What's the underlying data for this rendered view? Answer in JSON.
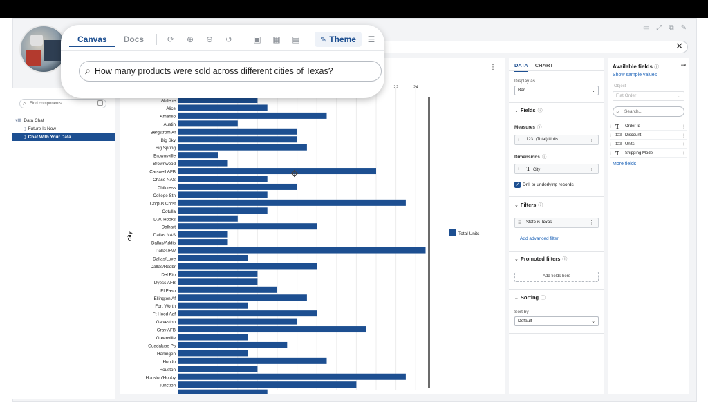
{
  "overlay": {
    "tabs": [
      {
        "label": "Canvas",
        "active": true
      },
      {
        "label": "Docs",
        "active": false
      }
    ],
    "toolbar_icons": [
      "refresh-icon",
      "zoom-in-icon",
      "zoom-out-icon",
      "zoom-reset-icon",
      "image-icon",
      "grid-icon",
      "layout-icon"
    ],
    "theme_label": "Theme",
    "question": "How many products were sold across different cities of Texas?"
  },
  "left": {
    "find_placeholder": "Find components",
    "tree": [
      {
        "label": "Data Chat",
        "level": 1,
        "selected": false
      },
      {
        "label": "Future Is Now",
        "level": 2,
        "selected": false
      },
      {
        "label": "Chat With Your Data",
        "level": 2,
        "selected": true
      }
    ]
  },
  "data_panel": {
    "tabs": [
      {
        "label": "DATA",
        "active": true
      },
      {
        "label": "CHART",
        "active": false
      }
    ],
    "display_as_label": "Display as",
    "display_as_value": "Bar",
    "fields_title": "Fields",
    "measures_label": "Measures",
    "measure_pill": "(Total) Units",
    "measure_type": "123",
    "dimensions_label": "Dimensions",
    "dimension_pill": "City",
    "drill_label": "Drill to underlying records",
    "filters_title": "Filters",
    "filter_pill": "State is Texas",
    "add_filter_link": "Add advanced filter",
    "promoted_title": "Promoted filters",
    "add_fields_here": "Add fields here",
    "sorting_title": "Sorting",
    "sort_by_label": "Sort by",
    "sort_by_value": "Default"
  },
  "fields_panel": {
    "title": "Available fields",
    "sample_link": "Show sample values",
    "object_label": "Object",
    "object_value": "Flat Order",
    "search_placeholder": "Search...",
    "fields": [
      {
        "type": "T",
        "name": "Order Id"
      },
      {
        "type": "123",
        "name": "Discount"
      },
      {
        "type": "123",
        "name": "Units"
      },
      {
        "type": "T",
        "name": "Shipping Mode"
      }
    ],
    "more_link": "More fields"
  },
  "chart_data": {
    "type": "bar",
    "orientation": "horizontal",
    "ylabel": "City",
    "xlabel": "",
    "x_ticks_visible": [
      22,
      24
    ],
    "xlim": [
      0,
      25
    ],
    "legend": {
      "placement": "right",
      "entries": [
        "Total Units"
      ]
    },
    "bar_color": "#1d4f91",
    "series": [
      {
        "name": "Total Units",
        "values": [
          8,
          9,
          15,
          6,
          12,
          12,
          13,
          4,
          5,
          20,
          9,
          12,
          9,
          23,
          9,
          6,
          14,
          5,
          5,
          25,
          7,
          14,
          8,
          8,
          10,
          13,
          7,
          14,
          12,
          19,
          7,
          11,
          7,
          15,
          8,
          23,
          18,
          9
        ]
      }
    ],
    "categories": [
      "Abilene",
      "Alice",
      "Amarillo",
      "Austin",
      "Bergstrom Af",
      "Big Sky",
      "Big Spring",
      "Brownsville",
      "Brownwood",
      "Carswell AFB",
      "Chase NAS",
      "Childress",
      "College Stn",
      "Corpus Chrst",
      "Cotulla",
      "D.w. Hooks",
      "Dalhart",
      "Dallas NAS",
      "Dallas/Addis",
      "Dallas/FW",
      "Dallas/Love",
      "Dallas/Redbr",
      "Del Rio",
      "Dyess AFB",
      "El Paso",
      "Ellington Af",
      "Fort Worth",
      "Ft Hood Aaf",
      "Galveston",
      "Gray AFB",
      "Greenville",
      "Guadalupe Ps",
      "Harlingen",
      "Hondo",
      "Houston",
      "Houston/Hobby",
      "Junction"
    ]
  }
}
